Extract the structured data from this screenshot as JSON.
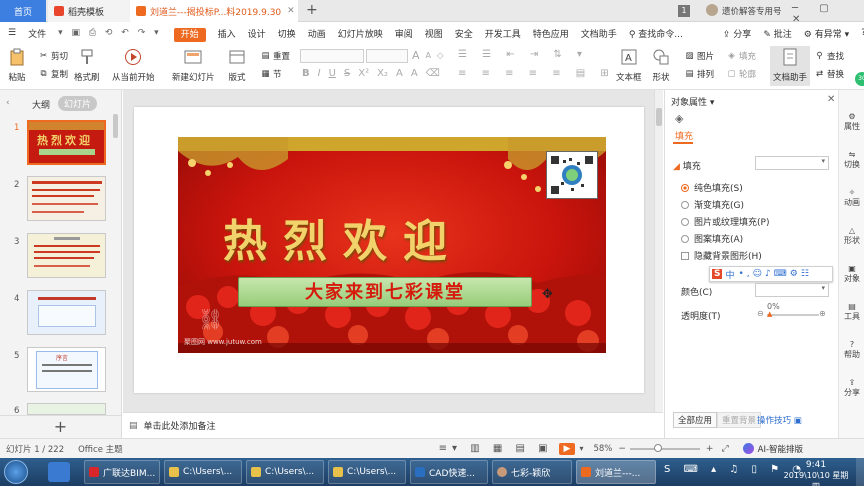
{
  "tabs": {
    "home": "首页",
    "template": "稻壳模板",
    "document": "刘道兰---揭投标P...料2019.9.30",
    "badge": "1",
    "question_hint": "遗价解答专用号"
  },
  "menu": {
    "file": "文件",
    "items": [
      "开始",
      "插入",
      "设计",
      "切换",
      "动画",
      "幻灯片放映",
      "审阅",
      "视图",
      "安全",
      "开发工具",
      "特色应用",
      "文档助手"
    ],
    "search": "查找命令...",
    "right": [
      "分享",
      "批注",
      "有异常"
    ]
  },
  "ribbon": {
    "paste": "粘贴",
    "cut": "剪切",
    "copy": "复制",
    "format_painter": "格式刷",
    "play_from_current": "从当前开始",
    "new_slide": "新建幻灯片",
    "layout": "版式",
    "section": "节",
    "reset": "重置",
    "textbox": "文本框",
    "shape": "形状",
    "arrange": "排列",
    "picture": "图片",
    "fill": "填充",
    "outline": "轮廓",
    "doc_helper": "文档助手",
    "find": "查找",
    "replace": "替换",
    "font_a_big": "A",
    "font_a_small": "A",
    "bold": "B",
    "italic": "I",
    "underline": "U",
    "strike": "S"
  },
  "leftpanel": {
    "outline_tab": "大纲",
    "slides_tab": "幻灯片",
    "slide_numbers": [
      "1",
      "2",
      "3",
      "4",
      "5",
      "6"
    ],
    "add": "+"
  },
  "slide": {
    "title": "热烈欢迎",
    "banner": "大家来到七彩课堂",
    "footer": "聚图网 www.jutuw.com"
  },
  "thumbs": {
    "t1_title": "热烈欢迎",
    "t5_title": "序言"
  },
  "notes": {
    "placeholder": "单击此处添加备注"
  },
  "rightpanel": {
    "title": "对象属性",
    "fill_tab": "填充",
    "fill_section": "填充",
    "options": [
      "纯色填充(S)",
      "渐变填充(G)",
      "图片或纹理填充(P)",
      "图案填充(A)"
    ],
    "hide_bg": "隐藏背景图形(H)",
    "color": "颜色(C)",
    "transparency": "透明度(T)",
    "transparency_value": "0%",
    "apply_all": "全部应用",
    "reset_bg": "重置背景",
    "tips": "操作技巧"
  },
  "ime": {
    "lang": "中"
  },
  "rail": [
    "属性",
    "切换",
    "动画",
    "形状",
    "对象",
    "工具",
    "帮助",
    "分享"
  ],
  "rail_badge": "30",
  "status": {
    "slide_info": "幻灯片 1 / 222",
    "theme": "Office 主题",
    "zoom": "58%",
    "ai": "AI-智能排版"
  },
  "taskbar": {
    "items": [
      "广联达BIM...",
      "C:\\Users\\...",
      "C:\\Users\\...",
      "C:\\Users\\...",
      "CAD快速...",
      "七彩-颖欣",
      "刘道兰---..."
    ],
    "time": "9:41",
    "date": "2019\\10\\10 星期四"
  },
  "colors": {
    "accent": "#ee6a21",
    "blue": "#3c7fe0",
    "slide_red": "#c8140c",
    "title_gold": "#f2d36b",
    "banner_green": "#a8d58b",
    "banner_text": "#d61a0c"
  }
}
